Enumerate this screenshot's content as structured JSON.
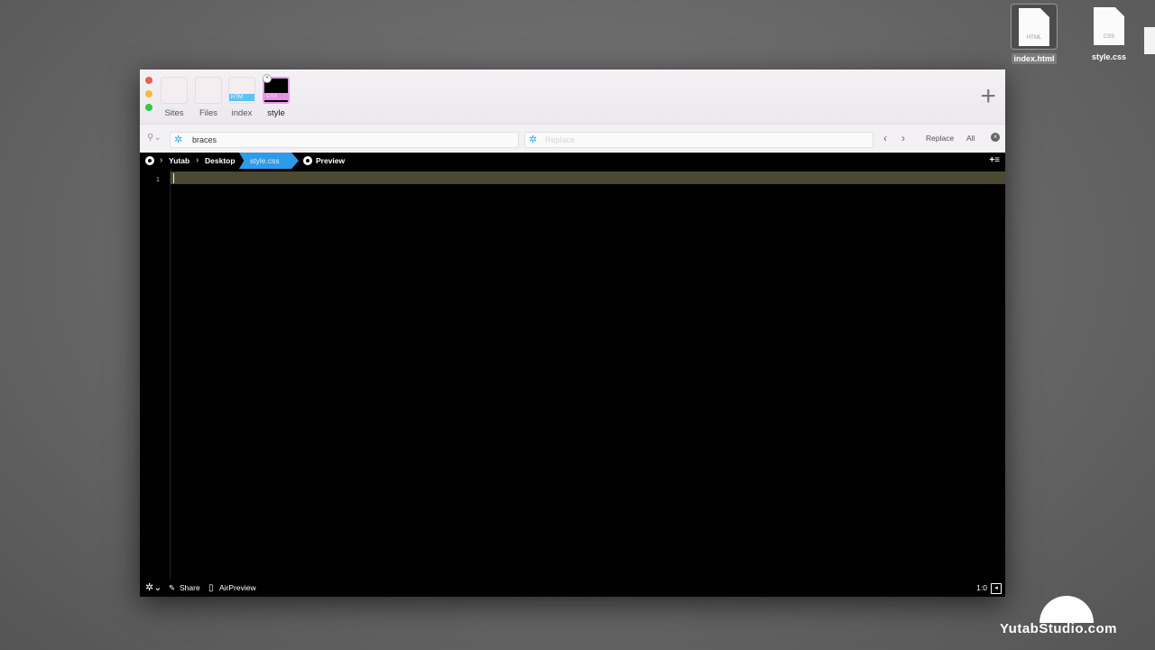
{
  "desktop": {
    "icons": [
      {
        "name": "index.html",
        "type": "HTML"
      },
      {
        "name": "style.css",
        "type": "CSS"
      }
    ]
  },
  "window": {
    "tabs": [
      {
        "label": "Sites"
      },
      {
        "label": "Files"
      },
      {
        "label": "index",
        "tag": "HTM"
      },
      {
        "label": "style",
        "tag": "CSS"
      }
    ],
    "tab_close_glyph": "×",
    "add_glyph": "+",
    "find": {
      "search_value": "braces",
      "replace_placeholder": "Replace",
      "prev_glyph": "‹",
      "next_glyph": "›",
      "replace_label": "Replace",
      "all_label": "All"
    },
    "path": {
      "crumbs": [
        "Yutab",
        "Desktop",
        "style.css"
      ],
      "preview_label": "Preview"
    },
    "editor": {
      "line_numbers": [
        "1"
      ],
      "current_line_color": "#4a4a33"
    },
    "status": {
      "share_label": "Share",
      "airpreview_label": "AirPreview",
      "cursor_position": "1:0"
    }
  },
  "watermark": {
    "text": "YutabStudio.com"
  },
  "colors": {
    "accent": "#2e9bea",
    "css_tab": "#e58fe6",
    "html_tag": "#5cc4f2"
  }
}
